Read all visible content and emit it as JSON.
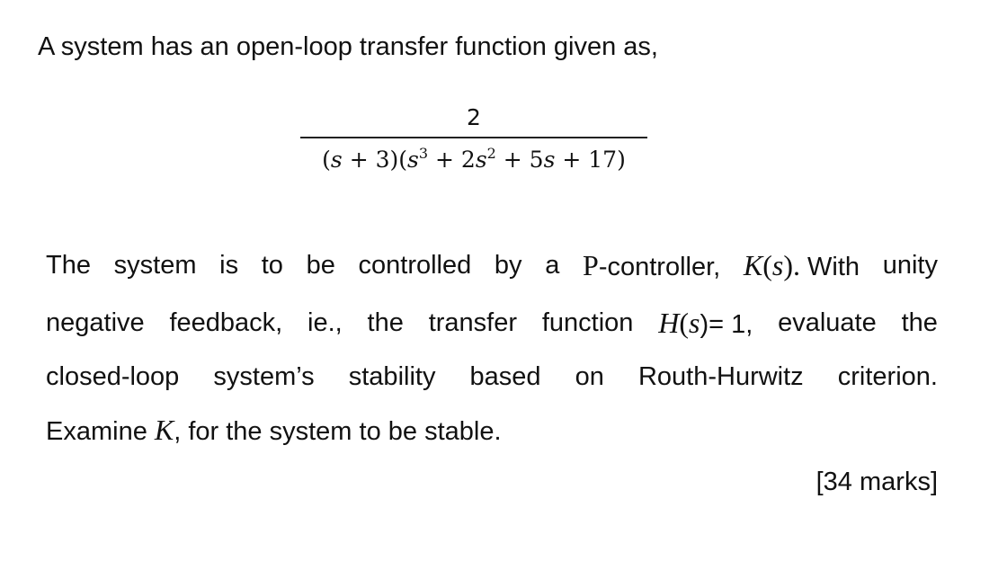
{
  "intro": "A system has an open-loop transfer function given as,",
  "transfer_function": {
    "numerator": "2",
    "denominator": {
      "factor1": [
        "(",
        "s",
        " + 3)"
      ],
      "factor2_open": "(",
      "s": "s",
      "exp3": "3",
      "plus2": " + 2",
      "exp2": "2",
      "plus5": " + 5",
      "tail": " + 17)"
    }
  },
  "paragraph": {
    "line1": [
      "The",
      "system",
      "is",
      "to",
      "be",
      "controlled",
      "by",
      "a",
      "P-controller,",
      "K(s). With",
      "unity"
    ],
    "line1_parts": {
      "p": "P",
      "p_rest": "-controller,",
      "k": "K",
      "k_open": "(",
      "k_s": "s",
      "k_close": ").",
      "with": "With"
    },
    "line2": [
      "negative",
      "feedback,",
      "ie.,",
      "the",
      "transfer",
      "function",
      "H(s)= 1,",
      "evaluate",
      "the"
    ],
    "line2_parts": {
      "h": "H",
      "h_open": "(",
      "h_s": "s",
      "h_close": ")= 1,"
    },
    "line3": [
      "closed-loop",
      "system’s",
      "stability",
      "based",
      "on",
      "Routh-Hurwitz",
      "criterion."
    ],
    "line4": {
      "before": "Examine ",
      "k": "K",
      "after": ", for the system to be stable."
    }
  },
  "marks": "[34 marks]"
}
